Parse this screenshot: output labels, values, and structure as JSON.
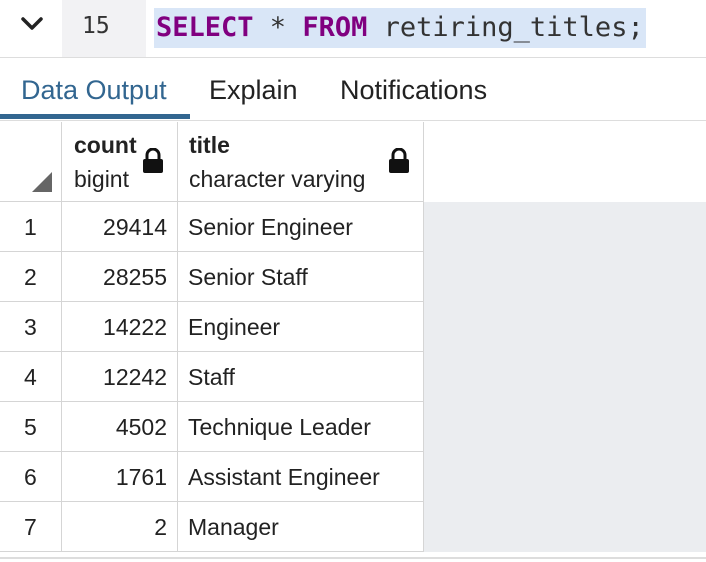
{
  "editor": {
    "line_number": "15",
    "query_keyword_select": "SELECT",
    "query_star": " * ",
    "query_keyword_from": "FROM",
    "query_rest": " retiring_titles;"
  },
  "tabs": [
    {
      "label": "Data Output",
      "active": true
    },
    {
      "label": "Explain",
      "active": false
    },
    {
      "label": "Notifications",
      "active": false
    }
  ],
  "grid": {
    "columns": [
      {
        "name": "count",
        "type": "bigint",
        "locked": true
      },
      {
        "name": "title",
        "type": "character varying",
        "locked": true
      }
    ],
    "rows": [
      {
        "index": "1",
        "count": "29414",
        "title": "Senior Engineer"
      },
      {
        "index": "2",
        "count": "28255",
        "title": "Senior Staff"
      },
      {
        "index": "3",
        "count": "14222",
        "title": "Engineer"
      },
      {
        "index": "4",
        "count": "12242",
        "title": "Staff"
      },
      {
        "index": "5",
        "count": "4502",
        "title": "Technique Leader"
      },
      {
        "index": "6",
        "count": "1761",
        "title": "Assistant Engineer"
      },
      {
        "index": "7",
        "count": "2",
        "title": "Manager"
      }
    ]
  },
  "colors": {
    "accent": "#326690",
    "keyword": "#800080",
    "selection": "#d9e6f7",
    "empty_grid": "#ebedf0"
  },
  "icons": [
    "chevron-down-icon",
    "lock-icon",
    "select-all-corner-icon"
  ]
}
